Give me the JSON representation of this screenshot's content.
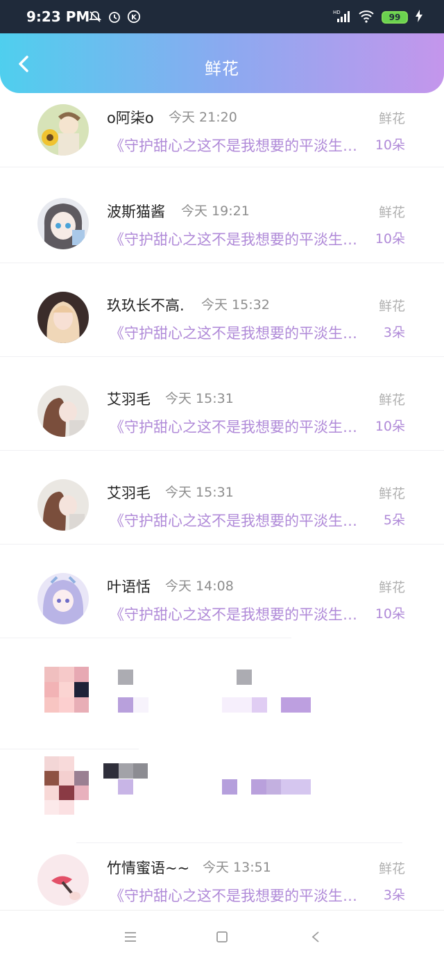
{
  "status": {
    "time": "9:23 PM",
    "battery": "99",
    "icons": [
      "mute-icon",
      "alarm-icon",
      "k-app-icon",
      "hd-signal-icon",
      "wifi-icon",
      "battery-icon",
      "charging-icon"
    ]
  },
  "header": {
    "title": "鲜花",
    "back_icon": "chevron-left-icon",
    "gradient": [
      "#4fcfee",
      "#c496ec"
    ]
  },
  "rows": [
    {
      "name": "o阿柒o",
      "time": "今天 21:20",
      "book": "《守护甜心之这不是我想要的平淡生活》",
      "gift": "鲜花",
      "count": "10朵"
    },
    {
      "name": "波斯猫酱",
      "time": "今天 19:21",
      "book": "《守护甜心之这不是我想要的平淡生活》",
      "gift": "鲜花",
      "count": "10朵"
    },
    {
      "name": "玖玖长不高.",
      "time": "今天 15:32",
      "book": "《守护甜心之这不是我想要的平淡生活》",
      "gift": "鲜花",
      "count": "3朵"
    },
    {
      "name": "艾羽毛",
      "time": "今天 15:31",
      "book": "《守护甜心之这不是我想要的平淡生活》",
      "gift": "鲜花",
      "count": "10朵"
    },
    {
      "name": "艾羽毛",
      "time": "今天 15:31",
      "book": "《守护甜心之这不是我想要的平淡生活》",
      "gift": "鲜花",
      "count": "5朵"
    },
    {
      "name": "叶语恬",
      "time": "今天 14:08",
      "book": "《守护甜心之这不是我想要的平淡生活》",
      "gift": "鲜花",
      "count": "10朵"
    },
    {
      "name": "竹情蜜语~~",
      "time": "今天 13:51",
      "book": "《守护甜心之这不是我想要的平淡生活》",
      "gift": "鲜花",
      "count": "3朵"
    }
  ],
  "colors": {
    "accent_purple": "#b08ad8",
    "name": "#222222",
    "muted": "#8d8d8d"
  },
  "navbar": {
    "icons": [
      "menu-icon",
      "home-square-icon",
      "back-triangle-icon"
    ]
  }
}
